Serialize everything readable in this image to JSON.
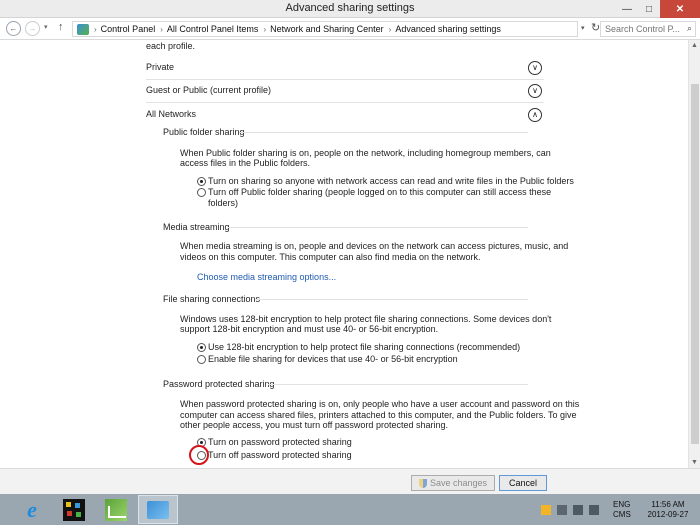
{
  "window": {
    "title": "Advanced sharing settings",
    "minimize": "—",
    "maximize": "□",
    "close": "✕"
  },
  "address": {
    "back_icon": "←",
    "forward_icon": "→",
    "recent_icon": "▾",
    "up_icon": "↑",
    "breadcrumbs": [
      "Control Panel",
      "All Control Panel Items",
      "Network and Sharing Center",
      "Advanced sharing settings"
    ],
    "breadcrumb_sep": "›",
    "dropdown_icon": "▾",
    "refresh_icon": "↻",
    "search_placeholder": "Search Control P...",
    "search_icon": "⌕"
  },
  "content": {
    "intro_tail": "each profile.",
    "profiles": {
      "private": "Private",
      "guest": "Guest or Public (current profile)",
      "all": "All Networks",
      "expand_icon": "∨",
      "collapse_icon": "∧"
    },
    "public_folder": {
      "heading": "Public folder sharing",
      "desc": [
        "When Public folder sharing is on, people on the network, including homegroup members, can",
        "access files in the Public folders."
      ],
      "option_on": "Turn on sharing so anyone with network access can read and write files in the Public folders",
      "option_off": [
        "Turn off Public folder sharing (people logged on to this computer can still access these",
        "folders)"
      ]
    },
    "media": {
      "heading": "Media streaming",
      "desc": [
        "When media streaming is on, people and devices on the network can access pictures, music, and",
        "videos on this computer. This computer can also find media on the network."
      ],
      "link": "Choose media streaming options..."
    },
    "file_sharing": {
      "heading": "File sharing connections",
      "desc": [
        "Windows uses 128-bit encryption to help protect file sharing connections. Some devices don't",
        "support 128-bit encryption and must use 40- or 56-bit encryption."
      ],
      "option_128": "Use 128-bit encryption to help protect file sharing connections (recommended)",
      "option_40": "Enable file sharing for devices that use 40- or 56-bit encryption"
    },
    "password": {
      "heading": "Password protected sharing",
      "desc": [
        "When password protected sharing is on, only people who have a user account and password on this",
        "computer can access shared files, printers attached to this computer, and the Public folders. To give",
        "other people access, you must turn off password protected sharing."
      ],
      "option_on": "Turn on password protected sharing",
      "option_off": "Turn off password protected sharing"
    }
  },
  "buttons": {
    "save": "Save changes",
    "cancel": "Cancel"
  },
  "taskbar": {
    "ie_glyph": "e",
    "language": [
      "ENG",
      "CMS"
    ],
    "time": "11:56 AM",
    "date": "2012-09-27"
  },
  "colors": {
    "link": "#1f5bb0",
    "highlight_ring": "#d4141a",
    "taskbar": "#9aa6b0",
    "close_button": "#c7473a"
  }
}
